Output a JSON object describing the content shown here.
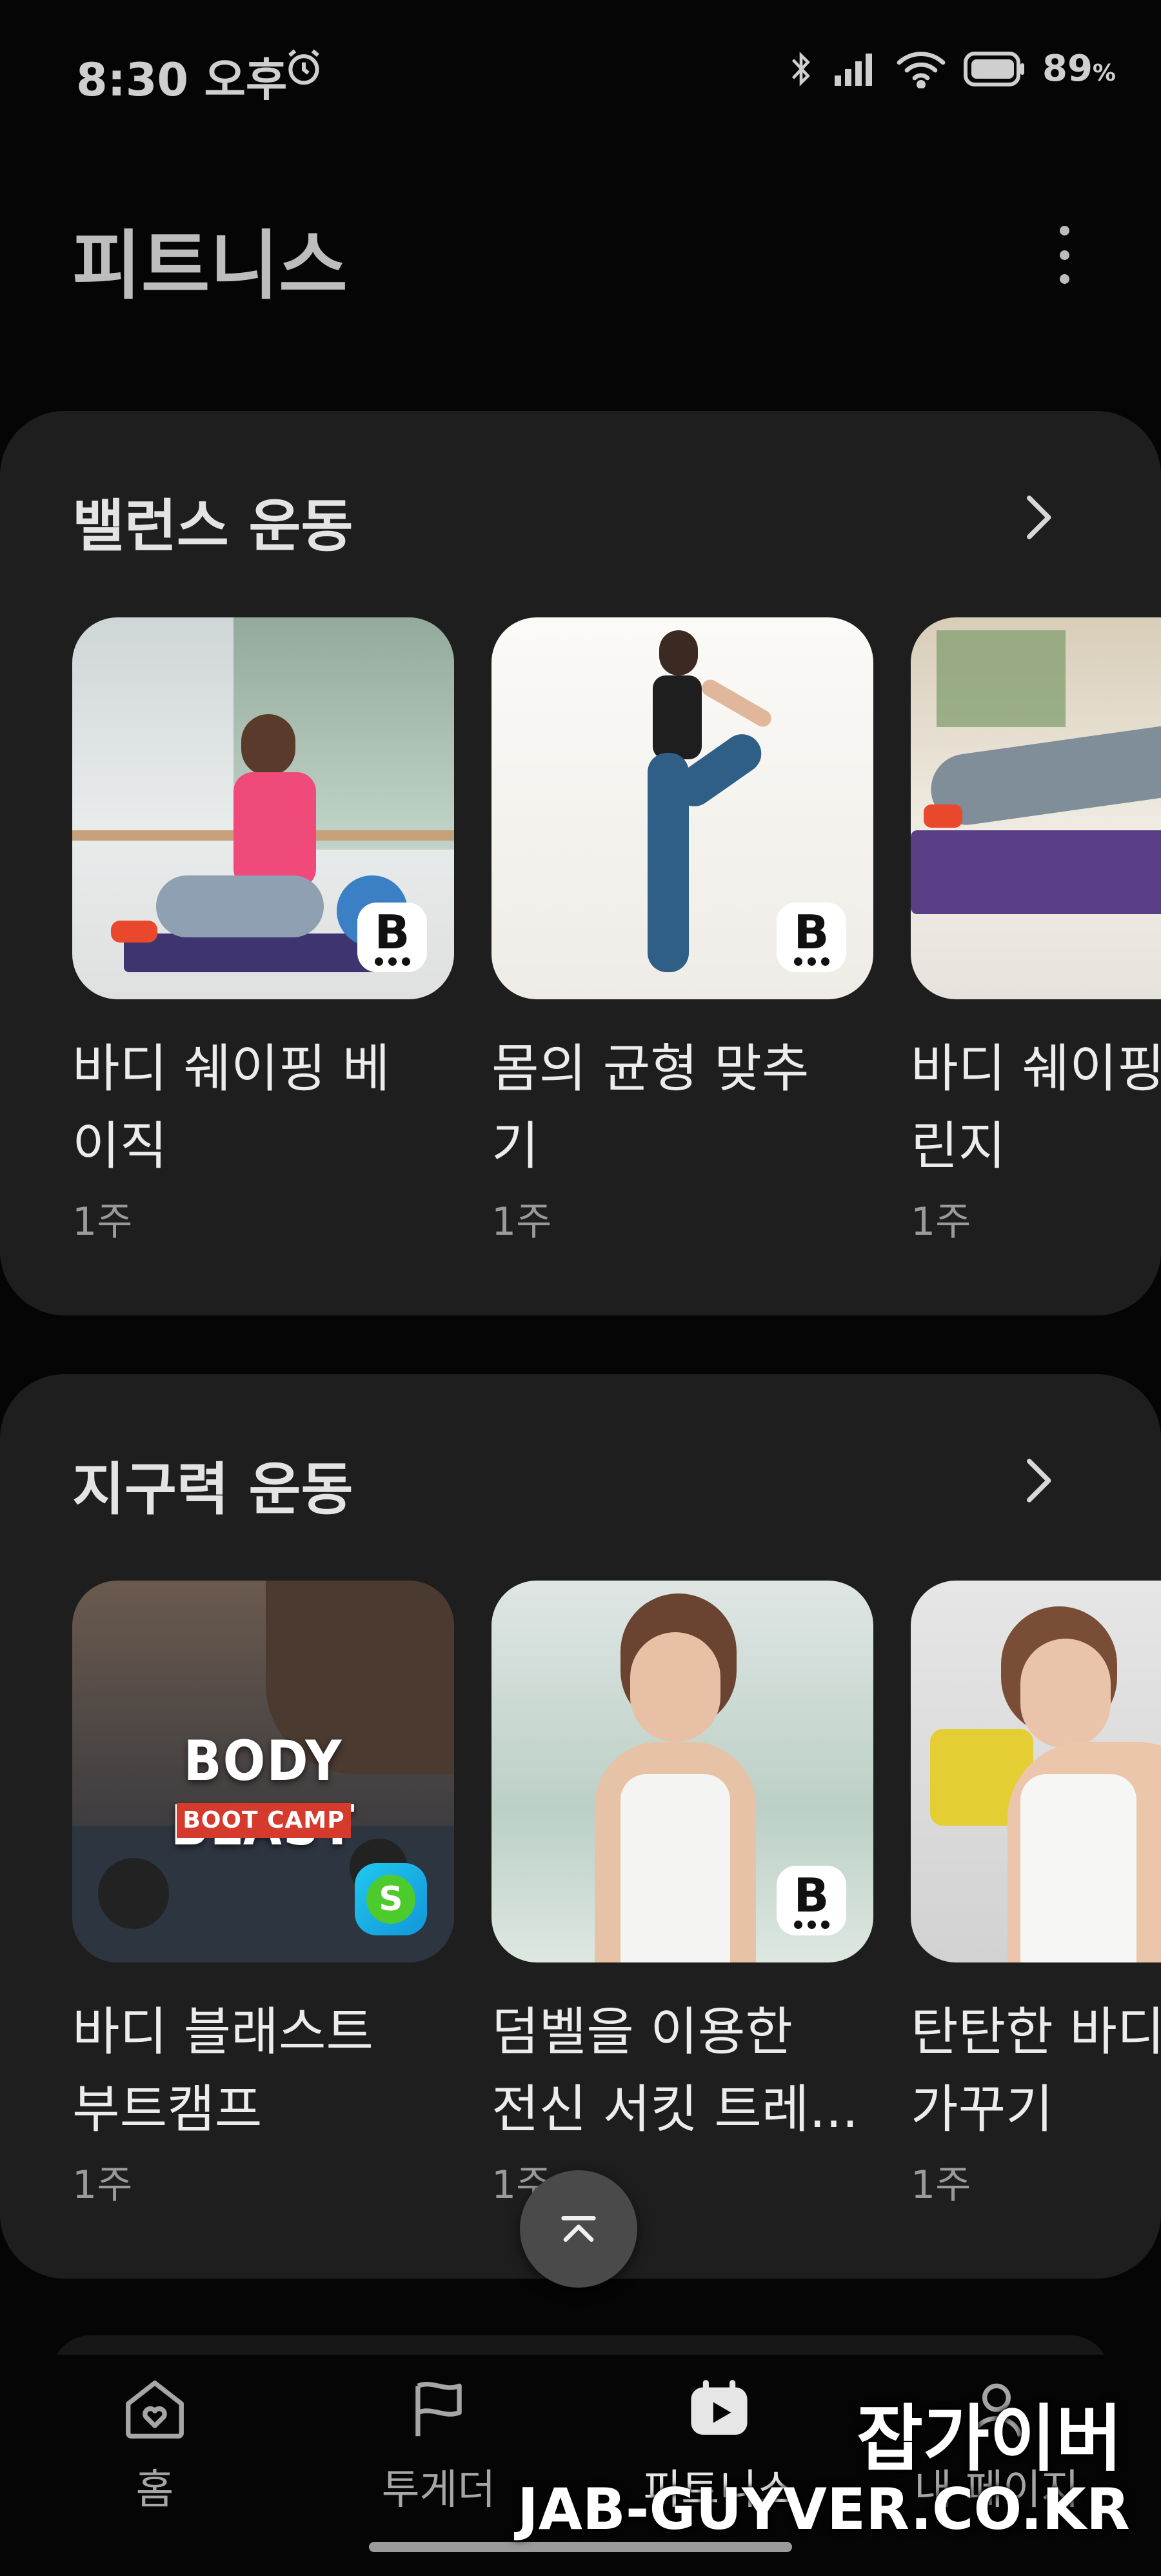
{
  "status_bar": {
    "time": "8:30 오후",
    "battery": "89",
    "battery_unit": "%",
    "icons": [
      "alarm-icon",
      "bluetooth-icon",
      "signal-icon",
      "wifi-icon",
      "battery-icon"
    ]
  },
  "header": {
    "title": "피트니스",
    "more_icon": "more-vertical-icon"
  },
  "sections": [
    {
      "title": "밸런스 운동",
      "items": [
        {
          "title": "바디 쉐이핑 베\n이직",
          "duration": "1주"
        },
        {
          "title": "몸의 균형 맞추\n기",
          "duration": "1주"
        },
        {
          "title": "바디 쉐이핑\n린지",
          "duration": "1주"
        }
      ]
    },
    {
      "title": "지구력 운동",
      "items": [
        {
          "title": "바디 블래스트\n부트캠프",
          "duration": "1주",
          "thumb_text": "BODY BLAST",
          "thumb_tag": "BOOT CAMP"
        },
        {
          "title": "덤벨을 이용한\n전신 서킷 트레...",
          "duration": "1주"
        },
        {
          "title": "탄탄한 바디\n가꾸기",
          "duration": "1주"
        }
      ]
    }
  ],
  "badges": {
    "b_letter": "B",
    "s_letter": "S"
  },
  "bottom_nav": [
    {
      "label": "홈",
      "icon": "home-heart-icon"
    },
    {
      "label": "투게더",
      "icon": "flag-icon"
    },
    {
      "label": "피트니스",
      "icon": "play-calendar-icon",
      "active": true
    },
    {
      "label": "내 페이지",
      "icon": "person-icon"
    }
  ],
  "watermark": {
    "name": "잡가이버",
    "url": "JAB-GUYVER.CO.KR"
  },
  "colors": {
    "background": "#050505",
    "card": "#1e1e1e",
    "text": "#e8e8e8",
    "muted": "#9a9a9a"
  }
}
